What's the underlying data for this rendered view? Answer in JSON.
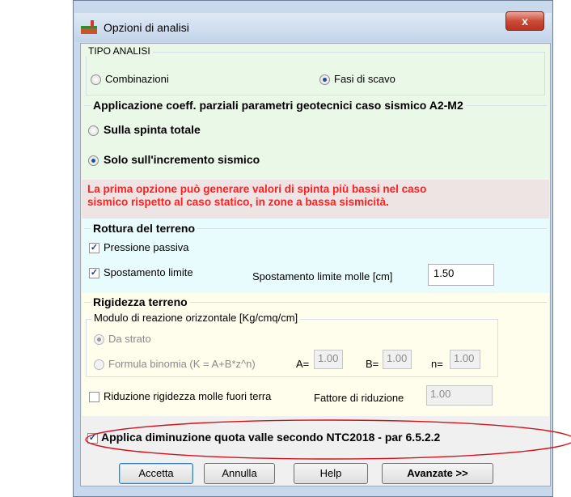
{
  "window": {
    "title": "Opzioni di analisi",
    "close_label": "x"
  },
  "tipo_analisi": {
    "legend": "TIPO ANALISI",
    "options": [
      {
        "label": "Combinazioni",
        "selected": false
      },
      {
        "label": "Fasi di scavo",
        "selected": true
      }
    ]
  },
  "coeff": {
    "legend": "Applicazione coeff. parziali parametri geotecnici caso sismico A2-M2",
    "options": [
      {
        "label": "Sulla spinta totale",
        "selected": false
      },
      {
        "label": "Solo sull'incremento sismico",
        "selected": true
      }
    ]
  },
  "warning": {
    "line1": "La prima opzione può generare valori di spinta più bassi nel caso",
    "line2": "sismico rispetto al caso statico, in zone a bassa sismicità."
  },
  "rottura": {
    "legend": "Rottura del terreno",
    "pressione_passiva": {
      "label": "Pressione passiva",
      "checked": true
    },
    "spostamento_limite": {
      "label": "Spostamento limite",
      "checked": true
    },
    "molle_label": "Spostamento limite molle [cm]",
    "molle_value": "1.50"
  },
  "rigidezza": {
    "legend": "Rigidezza terreno",
    "modulo_legend": "Modulo di reazione orizzontale [Kg/cmq/cm]",
    "da_strato": {
      "label": "Da strato",
      "selected": true
    },
    "formula": {
      "label": "Formula binomia (K = A+B*z^n)",
      "selected": false
    },
    "a_label": "A=",
    "a_value": "1.00",
    "b_label": "B=",
    "b_value": "1.00",
    "n_label": "n=",
    "n_value": "1.00",
    "riduzione": {
      "label": "Riduzione rigidezza molle fuori terra",
      "checked": false
    },
    "fattore_label": "Fattore di riduzione",
    "fattore_value": "1.00"
  },
  "ntc": {
    "label": "Applica diminuzione quota valle secondo NTC2018 - par 6.5.2.2",
    "checked": true
  },
  "buttons": {
    "accetta": "Accetta",
    "annulla": "Annulla",
    "help": "Help",
    "avanzate": "Avanzate >>"
  },
  "colors": {
    "green_panel": "#eaf8e7",
    "pink_panel": "#efe4e4",
    "cyan_panel": "#e8fbfd",
    "yellow_panel": "#fffdeb",
    "warning_text": "#ff1f1f",
    "highlight_ellipse": "#d5101a"
  }
}
